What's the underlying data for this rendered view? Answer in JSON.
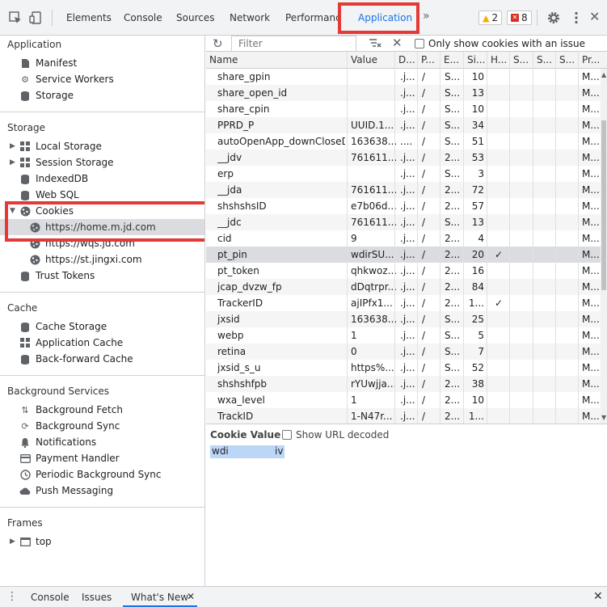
{
  "toolbar": {
    "tabs": [
      "Elements",
      "Console",
      "Sources",
      "Network",
      "Performance",
      "Application"
    ],
    "active_tab": "Application",
    "more_tabs": "»",
    "warnings": "2",
    "errors": "8"
  },
  "sidebar": {
    "application": {
      "title": "Application",
      "items": [
        "Manifest",
        "Service Workers",
        "Storage"
      ]
    },
    "storage": {
      "title": "Storage",
      "items": [
        "Local Storage",
        "Session Storage",
        "IndexedDB",
        "Web SQL",
        "Cookies"
      ],
      "cookie_sites": [
        "https://home.m.jd.com",
        "https://wqs.jd.com",
        "https://st.jingxi.com"
      ],
      "trust": "Trust Tokens"
    },
    "cache": {
      "title": "Cache",
      "items": [
        "Cache Storage",
        "Application Cache",
        "Back-forward Cache"
      ]
    },
    "background": {
      "title": "Background Services",
      "items": [
        "Background Fetch",
        "Background Sync",
        "Notifications",
        "Payment Handler",
        "Periodic Background Sync",
        "Push Messaging"
      ]
    },
    "frames": {
      "title": "Frames",
      "items": [
        "top"
      ]
    }
  },
  "filterbar": {
    "placeholder": "Filter",
    "only_issue_label": "Only show cookies with an issue"
  },
  "table": {
    "headers": [
      "Name",
      "Value",
      "D...",
      "P...",
      "E...",
      "Si...",
      "H...",
      "S...",
      "S...",
      "S...",
      "Pr..."
    ],
    "rows": [
      [
        "share_gpin",
        "",
        ".j...",
        "/",
        "S...",
        "10",
        "",
        "M..."
      ],
      [
        "share_open_id",
        "",
        ".j...",
        "/",
        "S...",
        "13",
        "",
        "M..."
      ],
      [
        "share_cpin",
        "",
        ".j...",
        "/",
        "S...",
        "10",
        "",
        "M..."
      ],
      [
        "PPRD_P",
        "UUID.1...",
        ".j...",
        "/",
        "S...",
        "34",
        "",
        "M..."
      ],
      [
        "autoOpenApp_downCloseD...",
        "163638...",
        "....",
        "/",
        "S...",
        "51",
        "",
        "M..."
      ],
      [
        "__jdv",
        "761611...",
        ".j...",
        "/",
        "2...",
        "53",
        "",
        "M..."
      ],
      [
        "erp",
        "",
        ".j...",
        "/",
        "S...",
        "3",
        "",
        "M..."
      ],
      [
        "__jda",
        "761611...",
        ".j...",
        "/",
        "2...",
        "72",
        "",
        "M..."
      ],
      [
        "shshshsID",
        "e7b06d...",
        ".j...",
        "/",
        "2...",
        "57",
        "",
        "M..."
      ],
      [
        "__jdc",
        "761611...",
        ".j...",
        "/",
        "S...",
        "13",
        "",
        "M..."
      ],
      [
        "cid",
        "9",
        ".j...",
        "/",
        "2...",
        "4",
        "",
        "M..."
      ],
      [
        "pt_pin",
        "wdirSU...",
        ".j...",
        "/",
        "2...",
        "20",
        "✓",
        "M..."
      ],
      [
        "pt_token",
        "qhkwoz...",
        ".j...",
        "/",
        "2...",
        "16",
        "",
        "M..."
      ],
      [
        "jcap_dvzw_fp",
        "dDqtrpr...",
        ".j...",
        "/",
        "2...",
        "84",
        "",
        "M..."
      ],
      [
        "TrackerID",
        "ajIPfx1...",
        ".j...",
        "/",
        "2...",
        "1...",
        "✓",
        "M..."
      ],
      [
        "jxsid",
        "163638...",
        ".j...",
        "/",
        "S...",
        "25",
        "",
        "M..."
      ],
      [
        "webp",
        "1",
        ".j...",
        "/",
        "S...",
        "5",
        "",
        "M..."
      ],
      [
        "retina",
        "0",
        ".j...",
        "/",
        "S...",
        "7",
        "",
        "M..."
      ],
      [
        "jxsid_s_u",
        "https%...",
        ".j...",
        "/",
        "S...",
        "52",
        "",
        "M..."
      ],
      [
        "shshshfpb",
        "rYUwjja...",
        ".j...",
        "/",
        "2...",
        "38",
        "",
        "M..."
      ],
      [
        "wxa_level",
        "1",
        ".j...",
        "/",
        "2...",
        "10",
        "",
        "M..."
      ],
      [
        "TrackID",
        "1-N47r...",
        ".j...",
        "/",
        "2...",
        "1...",
        "",
        "M..."
      ]
    ]
  },
  "cookie_value": {
    "title": "Cookie Value",
    "decode_label": "Show URL decoded",
    "value": "wdi               iv"
  },
  "drawer": {
    "tabs": [
      "Console",
      "Issues",
      "What's New"
    ]
  }
}
